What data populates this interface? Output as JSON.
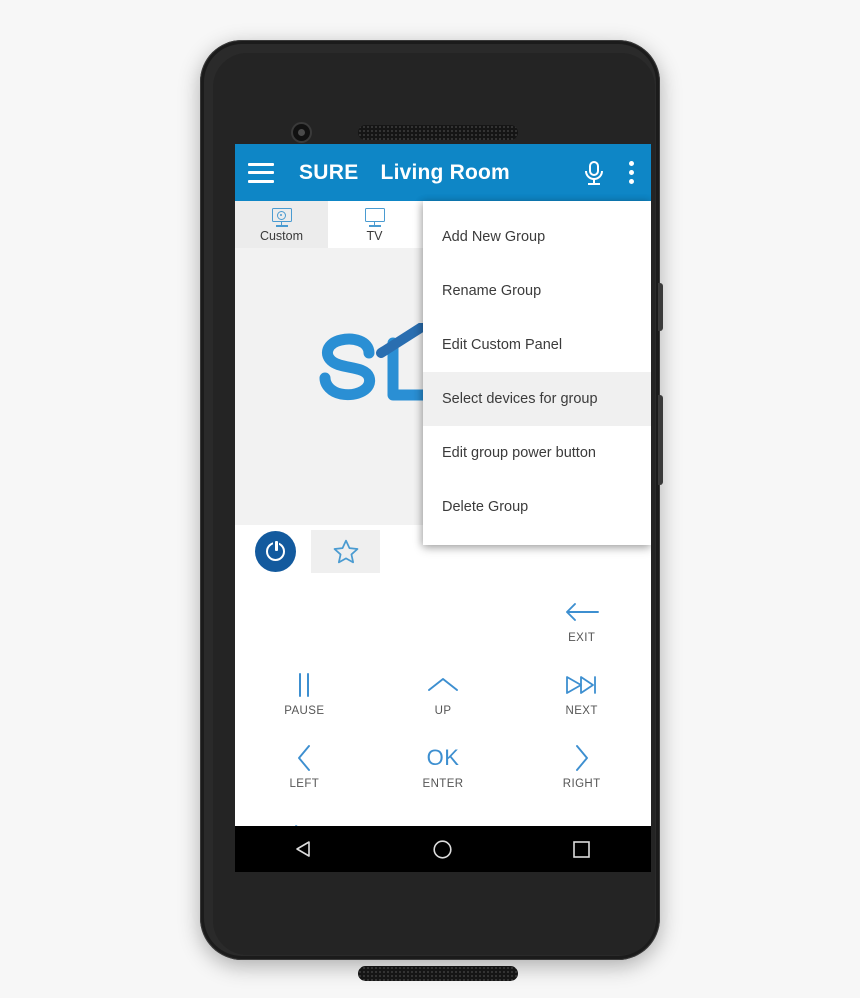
{
  "app_bar": {
    "menu_icon": "hamburger-icon",
    "brand": "SURE",
    "room": "Living Room",
    "mic_icon": "microphone-icon",
    "overflow_icon": "overflow-menu-icon",
    "background": "#0e86c6"
  },
  "tabs": [
    {
      "label": "Custom",
      "icon": "custom-panel-icon",
      "selected": true
    },
    {
      "label": "TV",
      "icon": "tv-icon",
      "selected": false
    }
  ],
  "watermark": {
    "icon": "sure-home-logo",
    "color_light": "#2a8fd4",
    "color_dark": "#2a6eb0"
  },
  "power_bar": {
    "power_icon": "power-icon",
    "favorite_icon": "star-outline-icon",
    "power_color": "#135a9e",
    "favorite_color": "#4a9bd1"
  },
  "overflow_menu": {
    "items": [
      {
        "label": "Add New Group",
        "highlighted": false
      },
      {
        "label": "Rename Group",
        "highlighted": false
      },
      {
        "label": "Edit Custom Panel",
        "highlighted": false
      },
      {
        "label": "Select devices for group",
        "highlighted": true
      },
      {
        "label": "Edit group power button",
        "highlighted": false
      },
      {
        "label": "Delete Group",
        "highlighted": false
      }
    ]
  },
  "remote_keys": {
    "rows": [
      [
        {
          "label": "",
          "icon": "",
          "empty": true
        },
        {
          "label": "",
          "icon": "",
          "empty": true
        },
        {
          "label": "EXIT",
          "icon": "arrow-left-icon",
          "empty": false
        }
      ],
      [
        {
          "label": "PAUSE",
          "icon": "pause-icon",
          "empty": false
        },
        {
          "label": "UP",
          "icon": "chevron-up-icon",
          "empty": false
        },
        {
          "label": "NEXT",
          "icon": "skip-next-icon",
          "empty": false
        }
      ],
      [
        {
          "label": "LEFT",
          "icon": "chevron-left-icon",
          "empty": false
        },
        {
          "label": "ENTER",
          "icon": "ok-text-icon",
          "icon_text": "OK",
          "empty": false
        },
        {
          "label": "RIGHT",
          "icon": "chevron-right-icon",
          "empty": false
        }
      ],
      [
        {
          "label": "",
          "icon": "play-icon",
          "empty": false
        },
        {
          "label": "",
          "icon": "chevron-down-icon",
          "empty": false
        },
        {
          "label": "",
          "icon": "stop-box-icon",
          "empty": false
        }
      ]
    ],
    "accent_color": "#3d8fd0"
  },
  "android_nav": {
    "back": "back-triangle-icon",
    "home": "home-circle-icon",
    "recents": "recents-square-icon"
  }
}
